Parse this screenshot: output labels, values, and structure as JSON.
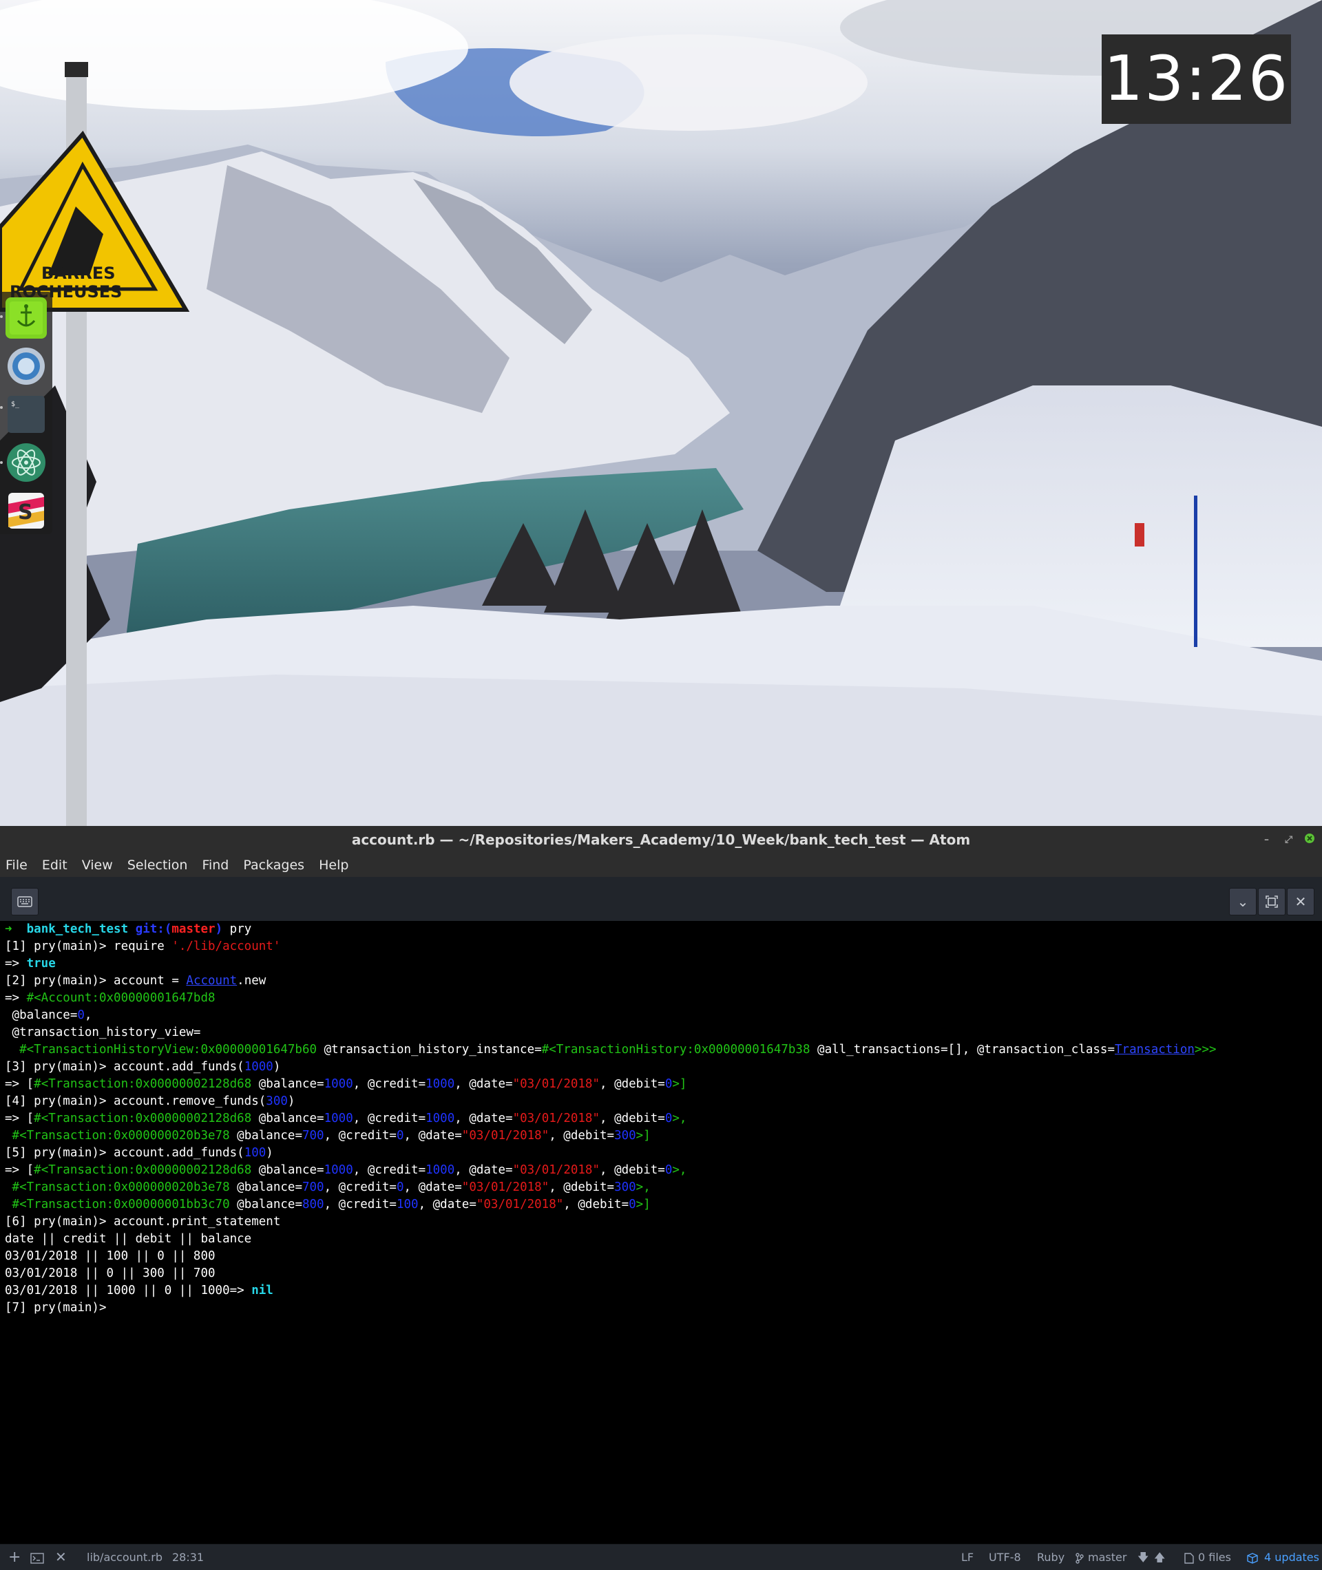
{
  "clock": {
    "time": "13:26"
  },
  "dock": {
    "items": [
      {
        "name": "anchor-app",
        "color": "#7ed321"
      },
      {
        "name": "chromium",
        "color": "#4a90c4"
      },
      {
        "name": "terminal",
        "color": "#3c4a55"
      },
      {
        "name": "atom",
        "color": "#2f8f6a"
      },
      {
        "name": "slack",
        "color": "#ffffff"
      }
    ]
  },
  "wallpaper": {
    "sign_text_1": "BARRES",
    "sign_text_2": "ROCHEUSES"
  },
  "window": {
    "title": "account.rb — ~/Repositories/Makers_Academy/10_Week/bank_tech_test — Atom",
    "menu": [
      "File",
      "Edit",
      "View",
      "Selection",
      "Find",
      "Packages",
      "Help"
    ]
  },
  "terminal": {
    "l1": {
      "arrow": "➜",
      "dir": "bank_tech_test",
      "git": "git:(",
      "branch": "master",
      "gitclose": ")",
      "cmd": " pry"
    },
    "l2": {
      "prompt": "[1] pry(main)> require ",
      "str": "'./lib/account'"
    },
    "l3": {
      "arrow": "=> ",
      "val": "true"
    },
    "l4": {
      "prompt": "[2] pry(main)> account = ",
      "cls": "Account",
      "rest": ".new"
    },
    "l5": {
      "arrow": "=> ",
      "obj": "#<Account:0x00000001647bd8"
    },
    "l6": {
      "ivar": " @balance=",
      "num": "0",
      "rest": ","
    },
    "l7": {
      "ivar": " @transaction_history_view="
    },
    "l8": {
      "obj": "  #<TransactionHistoryView:0x00000001647b60",
      "a": " @transaction_history_instance=",
      "obj2": "#<TransactionHistory:0x00000001647b38",
      "b": " @all_transactions=[], @transaction_class=",
      "cls": "Transaction",
      "end": ">>>"
    },
    "l9": {
      "prompt": "[3] pry(main)> account.add_funds(",
      "num": "1000",
      "end": ")"
    },
    "l10": {
      "a": "=> [",
      "obj": "#<Transaction:0x00000002128d68",
      "b": " @balance=",
      "n1": "1000",
      "c": ", @credit=",
      "n2": "1000",
      "d": ", @date=",
      "s": "\"03/01/2018\"",
      "e": ", @debit=",
      "n3": "0",
      "f": ">]"
    },
    "l11": {
      "prompt": "[4] pry(main)> account.remove_funds(",
      "num": "300",
      "end": ")"
    },
    "l12": {
      "a": "=> [",
      "obj": "#<Transaction:0x00000002128d68",
      "b": " @balance=",
      "n1": "1000",
      "c": ", @credit=",
      "n2": "1000",
      "d": ", @date=",
      "s": "\"03/01/2018\"",
      "e": ", @debit=",
      "n3": "0",
      "f": ">,"
    },
    "l13": {
      "a": " ",
      "obj": "#<Transaction:0x000000020b3e78",
      "b": " @balance=",
      "n1": "700",
      "c": ", @credit=",
      "n2": "0",
      "d": ", @date=",
      "s": "\"03/01/2018\"",
      "e": ", @debit=",
      "n3": "300",
      "f": ">]"
    },
    "l14": {
      "prompt": "[5] pry(main)> account.add_funds(",
      "num": "100",
      "end": ")"
    },
    "l15": {
      "a": "=> [",
      "obj": "#<Transaction:0x00000002128d68",
      "b": " @balance=",
      "n1": "1000",
      "c": ", @credit=",
      "n2": "1000",
      "d": ", @date=",
      "s": "\"03/01/2018\"",
      "e": ", @debit=",
      "n3": "0",
      "f": ">,"
    },
    "l16": {
      "a": " ",
      "obj": "#<Transaction:0x000000020b3e78",
      "b": " @balance=",
      "n1": "700",
      "c": ", @credit=",
      "n2": "0",
      "d": ", @date=",
      "s": "\"03/01/2018\"",
      "e": ", @debit=",
      "n3": "300",
      "f": ">,"
    },
    "l17": {
      "a": " ",
      "obj": "#<Transaction:0x00000001bb3c70",
      "b": " @balance=",
      "n1": "800",
      "c": ", @credit=",
      "n2": "100",
      "d": ", @date=",
      "s": "\"03/01/2018\"",
      "e": ", @debit=",
      "n3": "0",
      "f": ">]"
    },
    "l18": "[6] pry(main)> account.print_statement",
    "l19": "date || credit || debit || balance",
    "l20": "03/01/2018 || 100 || 0 || 800",
    "l21": "03/01/2018 || 0 || 300 || 700",
    "l22": {
      "text": "03/01/2018 || 1000 || 0 || 1000=> ",
      "nil": "nil"
    },
    "l23": "[7] pry(main)> "
  },
  "statusbar": {
    "file": "lib/account.rb",
    "cursor": "28:31",
    "line_ending": "LF",
    "encoding": "UTF-8",
    "grammar": "Ruby",
    "branch": "master",
    "files": "0 files",
    "updates": "4 updates"
  }
}
